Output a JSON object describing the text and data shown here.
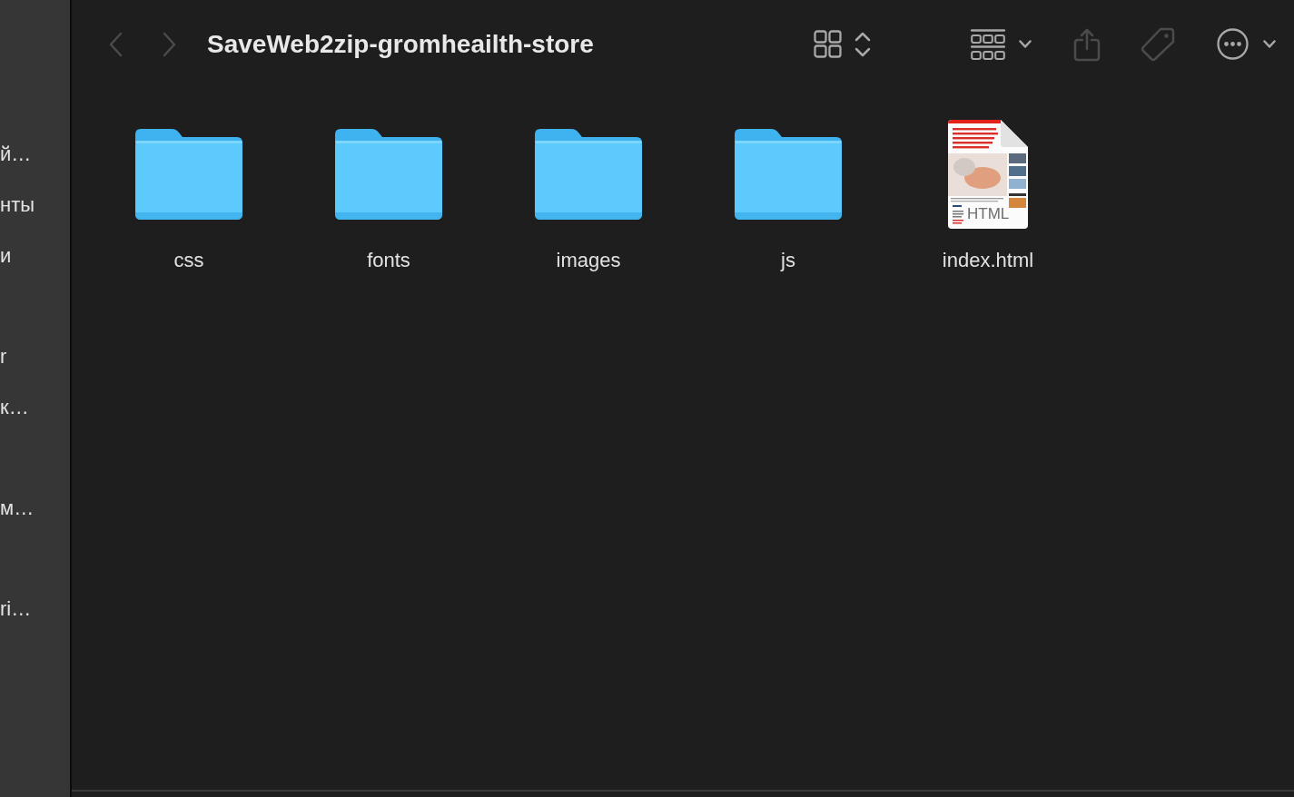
{
  "window": {
    "title": "SaveWeb2zip-gromheailth-store"
  },
  "sidebar": {
    "sections": [
      {
        "items": [
          {
            "label": "й…"
          },
          {
            "label": "нты"
          },
          {
            "label": "и"
          }
        ]
      },
      {
        "items": [
          {
            "label": "r"
          },
          {
            "label": "к…"
          }
        ]
      },
      {
        "items": [
          {
            "label": "м…"
          }
        ]
      },
      {
        "items": [
          {
            "label": "ri…"
          }
        ]
      }
    ]
  },
  "toolbar": {
    "navigation": [
      {
        "kind": "back",
        "disabled": true
      },
      {
        "kind": "forward",
        "disabled": true
      }
    ],
    "buttons": [
      {
        "kind": "view",
        "disabled": false
      },
      {
        "kind": "group",
        "disabled": false
      },
      {
        "kind": "share",
        "disabled": true
      },
      {
        "kind": "tag",
        "disabled": true
      },
      {
        "kind": "more",
        "disabled": false
      }
    ]
  },
  "files": [
    {
      "kind": "folder",
      "name": "css"
    },
    {
      "kind": "folder",
      "name": "fonts"
    },
    {
      "kind": "folder",
      "name": "images"
    },
    {
      "kind": "folder",
      "name": "js"
    },
    {
      "kind": "document",
      "name": "index.html",
      "badge": "HTML"
    }
  ]
}
